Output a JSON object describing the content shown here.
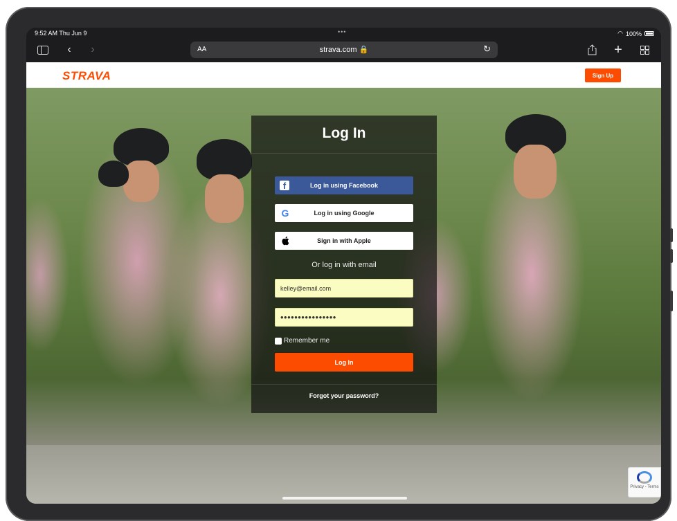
{
  "statusbar": {
    "time": "9:52 AM  Thu Jun 9",
    "dots": "•••",
    "battery": "100%",
    "wifi_icon": "wifi-icon"
  },
  "browser": {
    "aa_label": "AA",
    "url": "strava.com 🔒",
    "icons": [
      "sidebar-icon",
      "back-icon",
      "forward-icon",
      "reload-icon",
      "share-icon",
      "new-tab-icon",
      "tabs-grid-icon"
    ]
  },
  "site": {
    "logo": "STRAVA",
    "signup_label": "Sign Up",
    "brand_color": "#fc4c02"
  },
  "login": {
    "title": "Log In",
    "facebook_label": "Log in using Facebook",
    "google_label": "Log in using Google",
    "apple_label": "Sign in with Apple",
    "or_text": "Or log in with email",
    "email_value": "kelley@email.com",
    "password_value": "••••••••••••••••",
    "remember_label": "Remember me",
    "submit_label": "Log In",
    "forgot_label": "Forgot your password?"
  },
  "recaptcha": {
    "label": "Privacy - Terms"
  }
}
